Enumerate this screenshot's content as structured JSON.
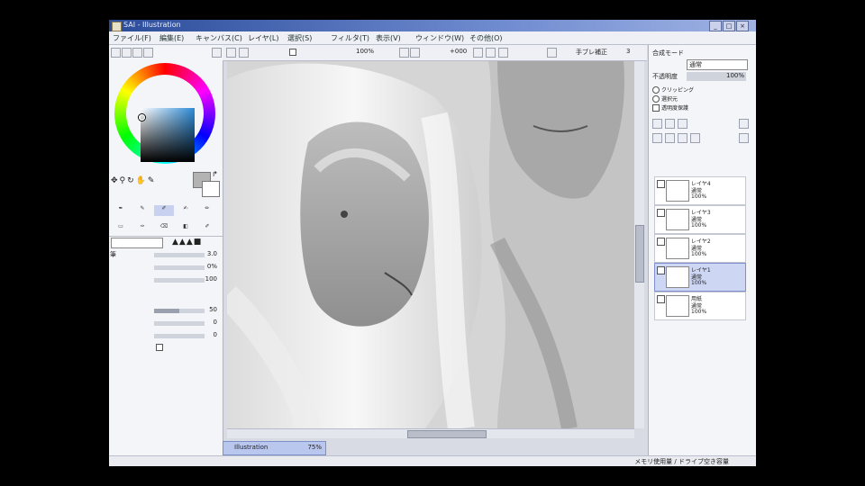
{
  "window": {
    "title": "SAI - Illustration"
  },
  "menu": {
    "items": [
      "ファイル(F)",
      "編集(E)",
      "キャンバス(C)",
      "レイヤ(L)",
      "選択(S)",
      "フィルタ(T)",
      "表示(V)",
      "ウィンドウ(W)",
      "その他(O)"
    ]
  },
  "canvas_toolbar": {
    "zoom": "100%",
    "angle": "+000",
    "blend_label": "手ブレ補正",
    "blend_value": "3"
  },
  "brush": {
    "name": "筆",
    "size": "3.0",
    "min_size": "0%",
    "density": "100",
    "blending": "50",
    "dilution": "0",
    "persistence": "0"
  },
  "canvas_tab": {
    "name": "Illustration",
    "zoom": "75%"
  },
  "status": {
    "text": "メモリ使用量 / ドライブ空き容量"
  },
  "layers_panel": {
    "mode_label": "合成モード",
    "mode_value": "通常",
    "opacity_label": "不透明度",
    "opacity_value": "100%",
    "options": [
      "クリッピング",
      "選択元",
      "透明度保護"
    ],
    "layers": [
      {
        "name": "レイヤ4",
        "mode": "通常",
        "opacity": "100%",
        "selected": false
      },
      {
        "name": "レイヤ3",
        "mode": "通常",
        "opacity": "100%",
        "selected": false
      },
      {
        "name": "レイヤ2",
        "mode": "通常",
        "opacity": "100%",
        "selected": false
      },
      {
        "name": "レイヤ1",
        "mode": "通常",
        "opacity": "100%",
        "selected": true
      },
      {
        "name": "用紙",
        "mode": "通常",
        "opacity": "100%",
        "selected": false
      }
    ]
  },
  "colors": {
    "primary": "#b3b3b3",
    "secondary": "#ffffff",
    "accent": "#2b4c9a"
  }
}
